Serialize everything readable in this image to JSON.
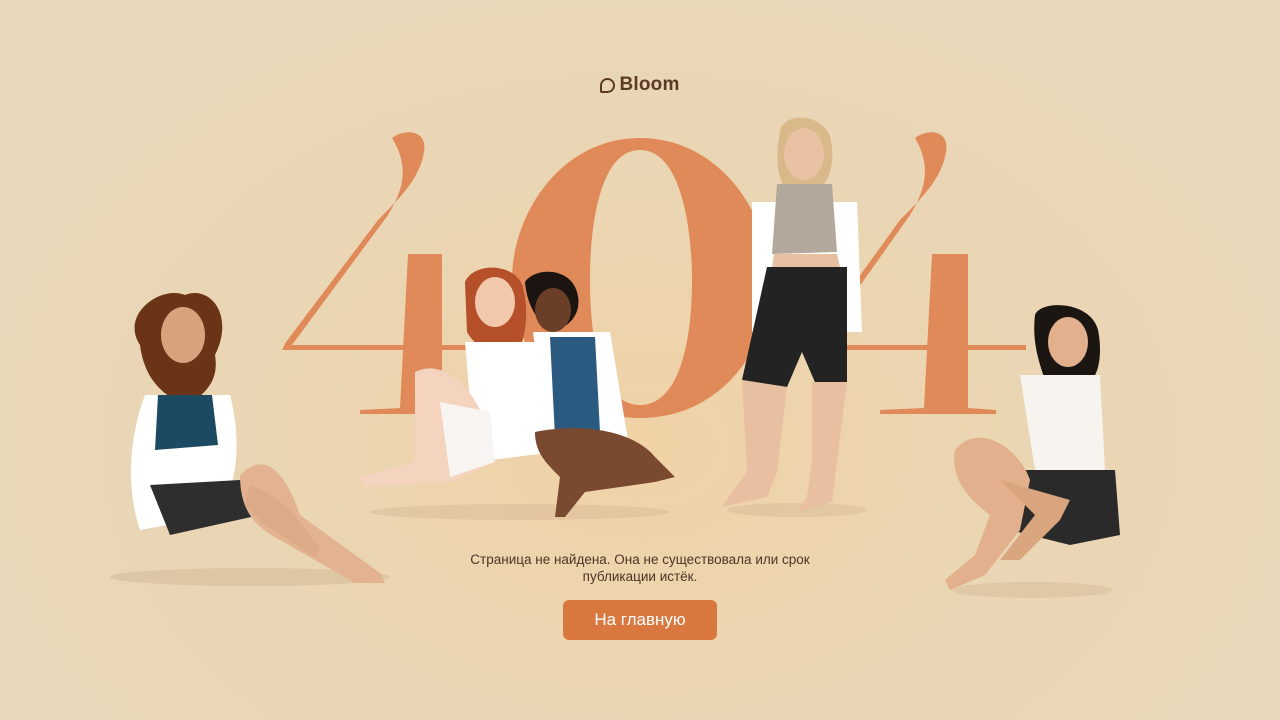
{
  "brand": {
    "logo_text": "Bloom",
    "accent_color": "#d9773f",
    "text_color": "#4b3526"
  },
  "hero": {
    "code": "404"
  },
  "message": {
    "text": "Страница не найдена. Она не существовала или срок публикации истёк."
  },
  "actions": {
    "home_label": "На главную"
  },
  "icons": {
    "logo": "bloom-logo-icon"
  }
}
